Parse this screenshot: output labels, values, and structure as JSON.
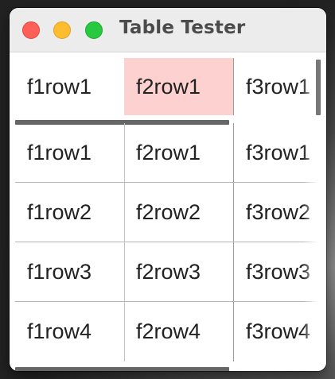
{
  "window": {
    "title": "Table Tester"
  },
  "header_table": {
    "cells": [
      "f1row1",
      "f2row1",
      "f3row1"
    ],
    "selected_index": 1,
    "selected_color": "#fdd1cf"
  },
  "body_table": {
    "rows": [
      [
        "f1row1",
        "f2row1",
        "f3row1"
      ],
      [
        "f1row2",
        "f2row2",
        "f3row2"
      ],
      [
        "f1row3",
        "f2row3",
        "f3row3"
      ],
      [
        "f1row4",
        "f2row4",
        "f3row4"
      ]
    ]
  },
  "colors": {
    "close": "#fe5f57",
    "minimize": "#febc2e",
    "maximize": "#28c840"
  }
}
